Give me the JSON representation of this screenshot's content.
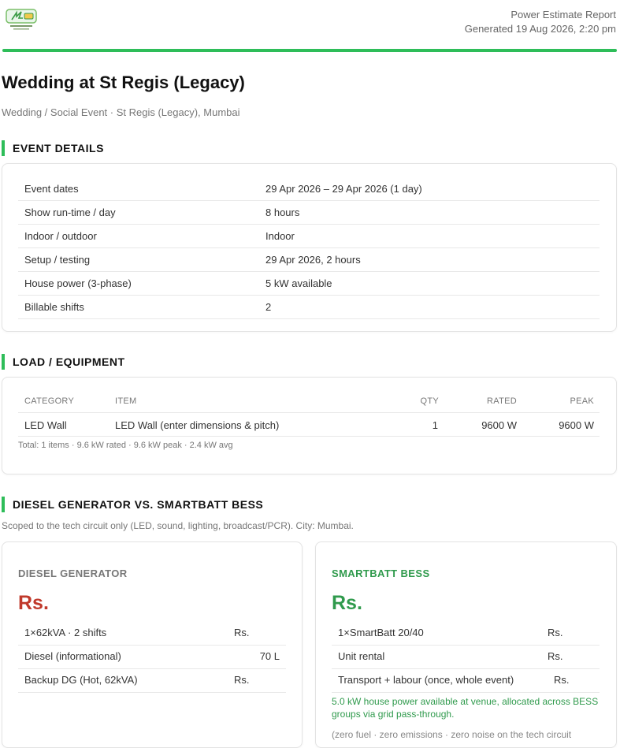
{
  "header": {
    "report_title": "Power Estimate Report",
    "generated": "Generated 19 Aug 2026, 2:20 pm",
    "logo_icon": "smartbatt-logo-icon",
    "accent_color": "#2ebd59"
  },
  "event": {
    "title": "Wedding at St Regis (Legacy)",
    "subtitle": "Wedding / Social Event · St Regis (Legacy), Mumbai"
  },
  "event_details": {
    "heading": "EVENT DETAILS",
    "rows": [
      {
        "label": "Event dates",
        "value": "29 Apr 2026 – 29 Apr 2026 (1 day)"
      },
      {
        "label": "Show run-time / day",
        "value": "8 hours"
      },
      {
        "label": "Indoor / outdoor",
        "value": "Indoor"
      },
      {
        "label": "Setup / testing",
        "value": "29 Apr 2026, 2 hours"
      },
      {
        "label": "House power (3-phase)",
        "value": "5 kW available"
      },
      {
        "label": "Billable shifts",
        "value": "2"
      }
    ]
  },
  "load": {
    "heading": "LOAD / EQUIPMENT",
    "columns": {
      "category": "CATEGORY",
      "item": "ITEM",
      "qty": "QTY",
      "rated": "RATED",
      "peak": "PEAK"
    },
    "rows": [
      {
        "category": "LED Wall",
        "item": "LED Wall (enter dimensions & pitch)",
        "qty": "1",
        "rated": "9600 W",
        "peak": "9600 W"
      }
    ],
    "totals": "Total: 1 items · 9.6 kW rated · 9.6 kW peak · 2.4 kW avg"
  },
  "comparison": {
    "heading": "DIESEL GENERATOR VS. SMARTBATT BESS",
    "scope": "Scoped to the tech circuit only (LED, sound, lighting, broadcast/PCR). City: Mumbai.",
    "diesel": {
      "heading": "DIESEL GENERATOR",
      "price": "Rs.",
      "color": "#c0392b",
      "rows": [
        {
          "label": "1×62kVA · 2 shifts",
          "value": "Rs."
        },
        {
          "label": "Diesel (informational)",
          "value": "70 L"
        },
        {
          "label": "Backup DG (Hot, 62kVA)",
          "value": "Rs."
        }
      ]
    },
    "bess": {
      "heading": "SMARTBATT BESS",
      "price": "Rs.",
      "color": "#2f9a4c",
      "rows": [
        {
          "label": "1×SmartBatt 20/40",
          "value": "Rs."
        },
        {
          "label": "Unit rental",
          "value": "Rs."
        },
        {
          "label": "Transport + labour (once, whole event)",
          "value": "Rs."
        }
      ],
      "note": "5.0 kW house power available at venue, allocated across BESS groups via grid pass-through.",
      "note2": "(zero fuel · zero emissions · zero noise on the tech circuit"
    }
  }
}
